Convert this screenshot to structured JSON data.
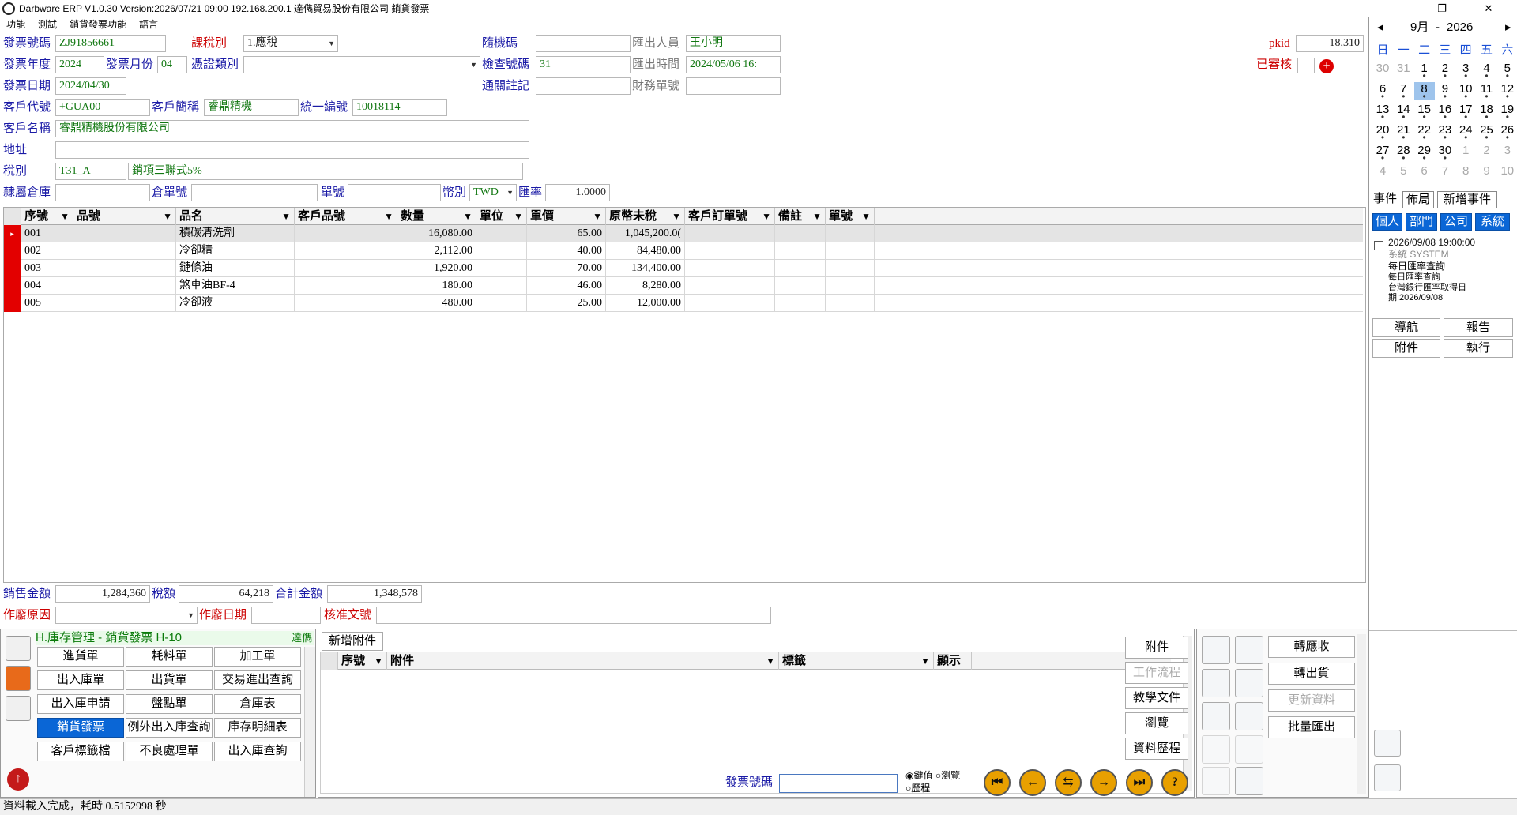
{
  "window": {
    "title": "Darbware ERP V1.0.30 Version:2026/07/21 09:00   192.168.200.1 達儁貿易股份有限公司 銷貨發票",
    "minimize_icon": "minimize-icon",
    "restore_icon": "restore-icon",
    "close_icon": "close-icon"
  },
  "menu": [
    "功能",
    "測試",
    "銷貨發票功能",
    "語言"
  ],
  "form": {
    "invoice_no_label": "發票號碼",
    "invoice_no": "ZJ91856661",
    "tax_type_label": "課稅別",
    "tax_type": "1.應稅",
    "random_code_label": "隨機碼",
    "random_code": "",
    "export_person_label": "匯出人員",
    "export_person": "王小明",
    "pkid_label": "pkid",
    "pkid": "18,310",
    "year_label": "發票年度",
    "year": "2024",
    "month_label": "發票月份",
    "month": "04",
    "voucher_type_label": "憑證類別",
    "voucher_type": "",
    "check_code_label": "檢查號碼",
    "check_code": "31",
    "export_time_label": "匯出時間",
    "export_time": "2024/05/06 16:",
    "reviewed_label": "已審核",
    "date_label": "發票日期",
    "date": "2024/04/30",
    "customs_label": "通關註記",
    "customs": "",
    "finance_no_label": "財務單號",
    "finance_no": "",
    "cust_code_label": "客戶代號",
    "cust_code": "+GUA00",
    "cust_short_label": "客戶簡稱",
    "cust_short": "睿鼎精機",
    "tax_id_label": "統一編號",
    "tax_id": "10018114",
    "cust_name_label": "客戶名稱",
    "cust_name": "睿鼎精機股份有限公司",
    "address_label": "地址",
    "address": "",
    "tax_cat_label": "稅別",
    "tax_cat_code": "T31_A",
    "tax_cat_name": "銷項三聯式5%",
    "warehouse_label": "隸屬倉庫",
    "warehouse": "",
    "wh_no_label": "倉單號",
    "wh_no": "",
    "doc_no_label": "單號",
    "doc_no": "",
    "currency_label": "幣別",
    "currency": "TWD",
    "rate_label": "匯率",
    "rate": "1.0000"
  },
  "grid": {
    "columns": [
      "序號",
      "品號",
      "品名",
      "客戶品號",
      "數量",
      "單位",
      "單價",
      "原幣未稅",
      "客戶訂單號",
      "備註",
      "單號"
    ],
    "rows": [
      [
        "001",
        "",
        "積碳清洗劑",
        "",
        "16,080.00",
        "",
        "65.00",
        "1,045,200.0(",
        "",
        "",
        ""
      ],
      [
        "002",
        "",
        "冷卻精",
        "",
        "2,112.00",
        "",
        "40.00",
        "84,480.00",
        "",
        "",
        ""
      ],
      [
        "003",
        "",
        "鏈條油",
        "",
        "1,920.00",
        "",
        "70.00",
        "134,400.00",
        "",
        "",
        ""
      ],
      [
        "004",
        "",
        "煞車油BF-4",
        "",
        "180.00",
        "",
        "46.00",
        "8,280.00",
        "",
        "",
        ""
      ],
      [
        "005",
        "",
        "冷卻液",
        "",
        "480.00",
        "",
        "25.00",
        "12,000.00",
        "",
        "",
        ""
      ]
    ]
  },
  "totals": {
    "sales_label": "銷售金額",
    "sales": "1,284,360",
    "tax_label": "稅額",
    "tax": "64,218",
    "total_label": "合計金額",
    "total": "1,348,578",
    "void_reason_label": "作廢原因",
    "void_reason": "",
    "void_date_label": "作廢日期",
    "void_date": "",
    "approval_label": "核准文號",
    "approval": ""
  },
  "module": {
    "header": "H.庫存管理 - 銷貨發票  H-10",
    "company_tag": "達儁",
    "buttons": [
      "進貨單",
      "耗料單",
      "加工單",
      "出入庫單",
      "出貨單",
      "交易進出查詢",
      "出入庫申請",
      "盤點單",
      "倉庫表",
      "銷貨發票",
      "例外出入庫查詢",
      "庫存明細表",
      "客戶標籤檔",
      "不良處理單",
      "出入庫查詢"
    ]
  },
  "attach": {
    "add_label": "新增附件",
    "columns": [
      "序號",
      "附件",
      "標籤",
      "顯示"
    ],
    "side_buttons": [
      "附件",
      "工作流程",
      "教學文件",
      "瀏覽",
      "資料歷程"
    ],
    "search_label": "發票號碼",
    "search_value": "",
    "radio_key": "鍵值",
    "radio_browse": "瀏覽",
    "radio_history": "歷程"
  },
  "actions": [
    "轉應收",
    "轉出貨",
    "更新資料",
    "批量匯出"
  ],
  "calendar": {
    "month": "9月",
    "year": "2026",
    "weekdays": [
      "日",
      "一",
      "二",
      "三",
      "四",
      "五",
      "六"
    ],
    "weeks": [
      [
        "30",
        "31",
        "1",
        "2",
        "3",
        "4",
        "5"
      ],
      [
        "6",
        "7",
        "8",
        "9",
        "10",
        "11",
        "12"
      ],
      [
        "13",
        "14",
        "15",
        "16",
        "17",
        "18",
        "19"
      ],
      [
        "20",
        "21",
        "22",
        "23",
        "24",
        "25",
        "26"
      ],
      [
        "27",
        "28",
        "29",
        "30",
        "1",
        "2",
        "3"
      ],
      [
        "4",
        "5",
        "6",
        "7",
        "8",
        "9",
        "10"
      ]
    ],
    "today": "8"
  },
  "events": {
    "tabs": [
      "事件",
      "佈局",
      "新增事件"
    ],
    "filters": [
      "個人",
      "部門",
      "公司",
      "系統"
    ],
    "item_time": "2026/09/08 19:00:00",
    "item_source": "系統  SYSTEM",
    "item_title": "每日匯率查詢",
    "item_desc1": "每日匯率查詢",
    "item_desc2": "台灣銀行匯率取得日",
    "item_desc3": "期:2026/09/08",
    "buttons": [
      "導航",
      "報告",
      "附件",
      "執行"
    ]
  },
  "status": "資料載入完成，耗時 0.5152998 秒"
}
